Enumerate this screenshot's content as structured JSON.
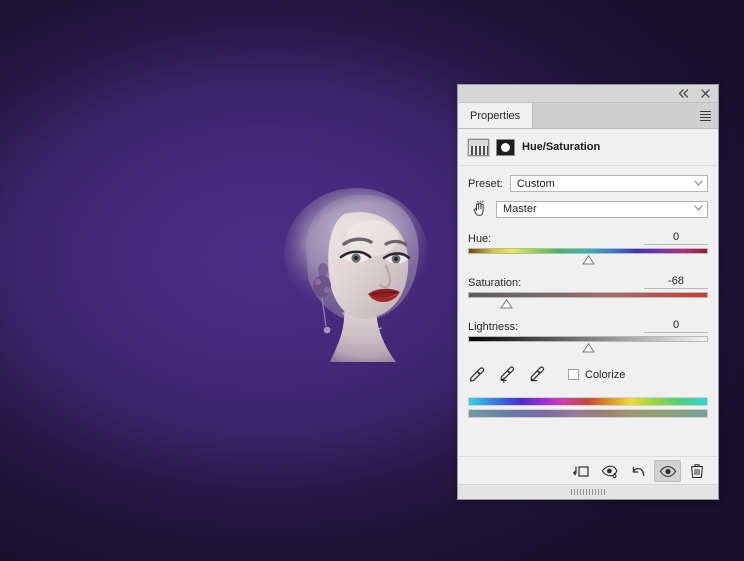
{
  "canvas": {
    "background_center_color": "#4c2d85",
    "background_edge_color": "#241940",
    "artwork_name": "portrait-photo"
  },
  "panel": {
    "tab_label": "Properties",
    "adjustment_title": "Hue/Saturation",
    "topbar": {
      "collapse_label": "«",
      "close_label": "✕"
    },
    "menu_label": "Panel menu",
    "preset": {
      "label": "Preset:",
      "value": "Custom",
      "chevron": "∨"
    },
    "channel": {
      "value": "Master",
      "chevron": "∨",
      "targeted_tool_name": "on-image-adjustment-tool"
    },
    "sliders": [
      {
        "label": "Hue:",
        "value": "0",
        "position_pct": 50,
        "track": "hue"
      },
      {
        "label": "Saturation:",
        "value": "-68",
        "position_pct": 16,
        "track": "sat"
      },
      {
        "label": "Lightness:",
        "value": "0",
        "position_pct": 50,
        "track": "light"
      }
    ],
    "eyedroppers": [
      {
        "name": "eyedropper-icon",
        "title": "Sample color"
      },
      {
        "name": "eyedropper-add-icon",
        "title": "Add to sample"
      },
      {
        "name": "eyedropper-subtract-icon",
        "title": "Subtract from sample"
      }
    ],
    "colorize": {
      "label": "Colorize",
      "checked": false
    },
    "range_bars": {
      "top_label": "adjusted-color-range",
      "bottom_label": "result-color-range"
    },
    "footer_buttons": [
      {
        "name": "clip-to-layer-button",
        "title": "Clip to layer",
        "active": false
      },
      {
        "name": "view-previous-state-button",
        "title": "View previous state",
        "active": false
      },
      {
        "name": "reset-button",
        "title": "Reset to adjustment defaults",
        "active": false
      },
      {
        "name": "toggle-visibility-button",
        "title": "Toggle layer visibility",
        "active": true
      },
      {
        "name": "delete-button",
        "title": "Delete this adjustment layer",
        "active": false
      }
    ]
  }
}
